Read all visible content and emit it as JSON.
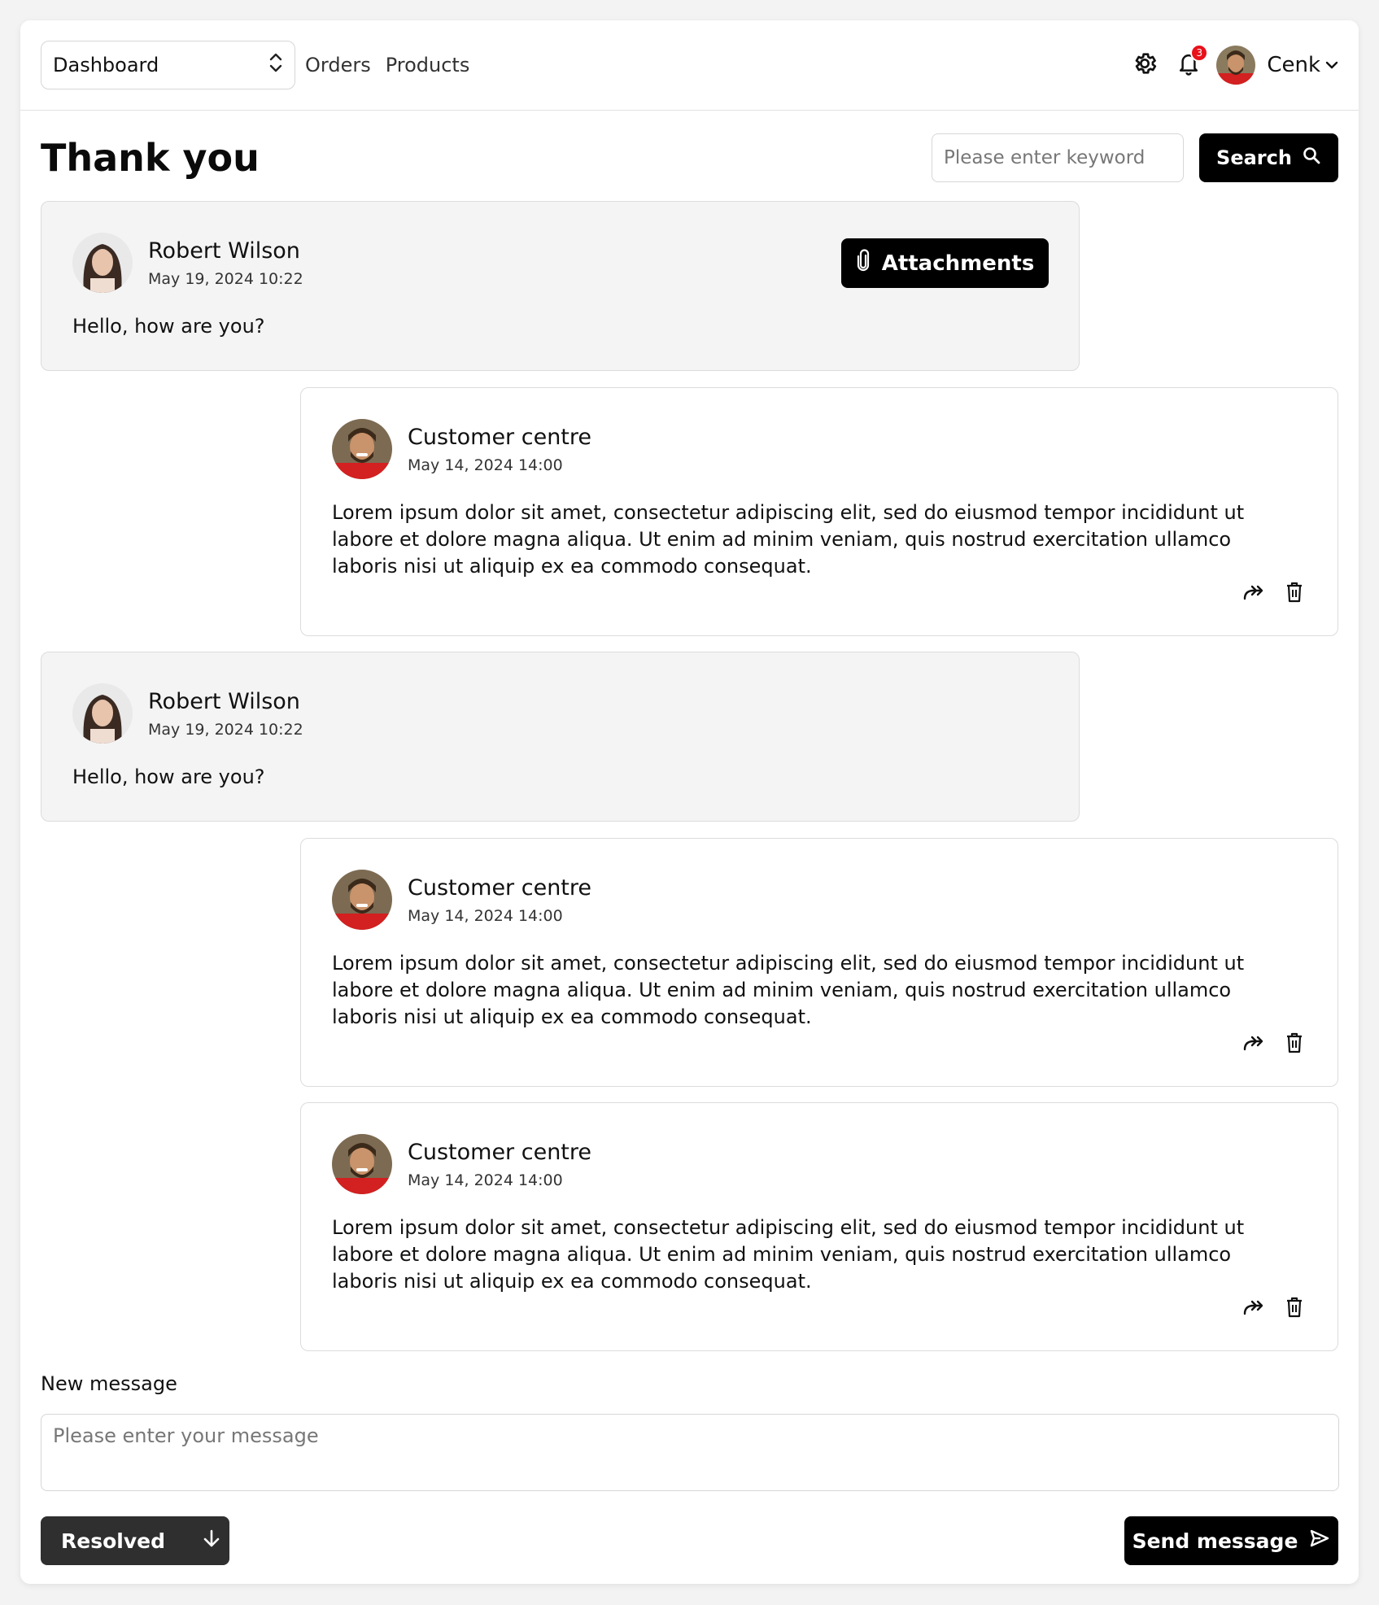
{
  "header": {
    "nav_select": "Dashboard",
    "links": [
      "Orders",
      "Products"
    ],
    "notification_count": "3",
    "user_name": "Cenk"
  },
  "page": {
    "title": "Thank you",
    "search_placeholder": "Please enter keyword",
    "search_label": "Search"
  },
  "messages": [
    {
      "type": "in",
      "author": "Robert Wilson",
      "date": "May 19, 2024 10:22",
      "text": "Hello, how are you?",
      "attachments_label": "Attachments"
    },
    {
      "type": "out",
      "author": "Customer centre",
      "date": "May 14, 2024 14:00",
      "text": "Lorem ipsum dolor sit amet, consectetur adipiscing elit, sed do eiusmod tempor incididunt ut labore et dolore magna aliqua. Ut enim ad minim veniam, quis nostrud exercitation ullamco laboris nisi ut aliquip ex ea commodo consequat."
    },
    {
      "type": "in",
      "author": "Robert Wilson",
      "date": "May 19, 2024 10:22",
      "text": "Hello, how are you?"
    },
    {
      "type": "out",
      "author": "Customer centre",
      "date": "May 14, 2024 14:00",
      "text": "Lorem ipsum dolor sit amet, consectetur adipiscing elit, sed do eiusmod tempor incididunt ut labore et dolore magna aliqua. Ut enim ad minim veniam, quis nostrud exercitation ullamco laboris nisi ut aliquip ex ea commodo consequat."
    },
    {
      "type": "out",
      "author": "Customer centre",
      "date": "May 14, 2024 14:00",
      "text": "Lorem ipsum dolor sit amet, consectetur adipiscing elit, sed do eiusmod tempor incididunt ut labore et dolore magna aliqua. Ut enim ad minim veniam, quis nostrud exercitation ullamco laboris nisi ut aliquip ex ea commodo consequat."
    }
  ],
  "composer": {
    "label": "New message",
    "placeholder": "Please enter your message",
    "status_label": "Resolved",
    "send_label": "Send message"
  },
  "colors": {
    "primary": "#000000",
    "badge": "#e8101a",
    "incoming_bg": "#f4f4f4",
    "status_btn": "#2f2f2f"
  }
}
